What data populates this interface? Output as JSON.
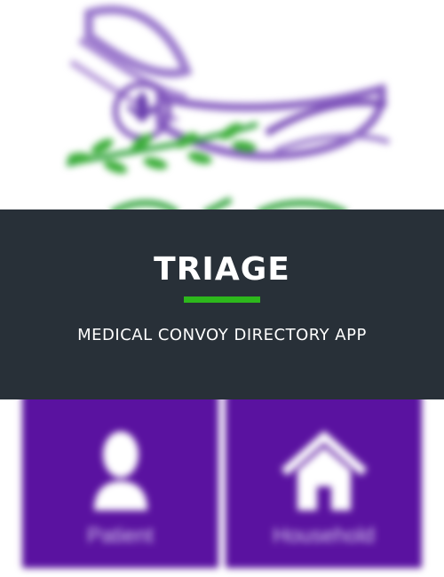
{
  "banner": {
    "title": "TRIAGE",
    "subtitle": "MEDICAL CONVOY DIRECTORY APP",
    "background_color": "#283038",
    "accent_color": "#2db81c"
  },
  "logo": {
    "icon": "dove-scout-emblem-logo",
    "colors": [
      "#7b4fb8",
      "#2fa33a"
    ]
  },
  "tiles": [
    {
      "label": "Patient",
      "icon": "person-icon",
      "color": "#5a12a0"
    },
    {
      "label": "Household",
      "icon": "house-icon",
      "color": "#5a12a0"
    }
  ]
}
